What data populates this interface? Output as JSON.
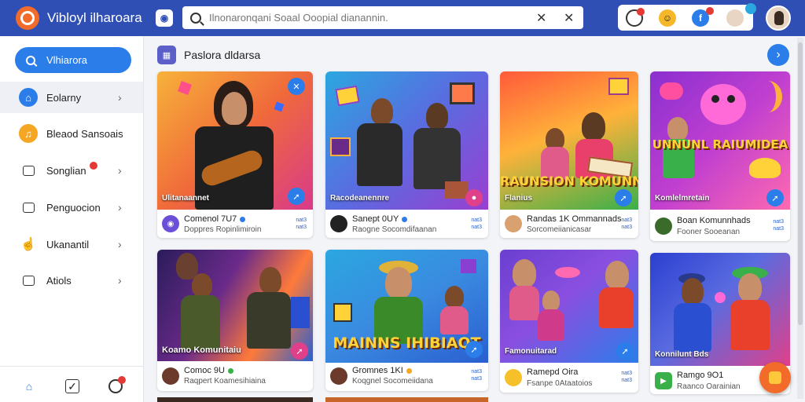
{
  "app": {
    "title": "Vibloyl ilharoara",
    "search_placeholder": "Ilnonaronqani Soaal Ooopial dianannin."
  },
  "sidebar": {
    "search_label": "Vlhiarora",
    "items": [
      {
        "label": "Eolarny"
      },
      {
        "label": "Bleaod Sansoais"
      },
      {
        "label": "Songlian"
      },
      {
        "label": "Penguocion"
      },
      {
        "label": "Ukanantil"
      },
      {
        "label": "Atiols"
      }
    ]
  },
  "section": {
    "title": "Paslora dldarsa"
  },
  "cards": [
    {
      "overlay": "Ulitanaannet",
      "banner": "",
      "title": "Comenol 7U7",
      "sub": "Doppres Ropinlimiroin",
      "stats": [
        "nat3",
        "nat3",
        "nat3"
      ],
      "colors": {
        "bg1": "#f09a2c",
        "bg2": "#e0408a",
        "av": "#6b4fd8",
        "dot": "#2b7de9",
        "btn": "#2b7de9"
      }
    },
    {
      "overlay": "Racodeanennre",
      "banner": "",
      "title": "Sanept 0UY",
      "sub": "Raogne Socomdifaanan",
      "stats": [
        "nat3",
        "nat3",
        "nat3"
      ],
      "colors": {
        "bg1": "#2ba7e0",
        "bg2": "#8a3fd0",
        "av": "#222222",
        "dot": "#2b7de9",
        "btn": "#e0408a"
      }
    },
    {
      "overlay": "Flanius",
      "banner": "RAUNSION KOMUNNS",
      "title": "Randas 1K Ommannads",
      "sub": "Sorcomeiianicasar",
      "stats": [
        "nat3",
        "nat3",
        "nat3"
      ],
      "colors": {
        "bg1": "#ff7a2e",
        "bg2": "#3ab04a",
        "av": "#d9a070",
        "dot": "",
        "btn": "#2b7de9"
      }
    },
    {
      "overlay": "Komlelmretain",
      "banner": "UNNUNL RAIUMIDEA",
      "title": "Boan Komunnhads",
      "sub": "Fooner Sooeanan",
      "stats": [
        "nat3",
        "nat3",
        "nat3"
      ],
      "colors": {
        "bg1": "#7a2fd0",
        "bg2": "#ff5aa8",
        "av": "#3a6b2a",
        "dot": "",
        "btn": "#2b7de9"
      }
    },
    {
      "overlay": "Koamo Komunitaiu",
      "banner": "",
      "title": "Comoc 9U",
      "sub": "Raqpert Koamesihiaina",
      "stats": [],
      "colors": {
        "bg1": "#3a2a8a",
        "bg2": "#e0408a",
        "av": "#6b3a2a",
        "dot": "#3ab04a",
        "btn": "#e0408a"
      }
    },
    {
      "overlay": "",
      "banner": "MAINNS IHIBIAQT",
      "title": "Gromnes 1KI",
      "sub": "Koqgnel Socomeiidana",
      "stats": [
        "nat3",
        "nat3",
        "nat3"
      ],
      "colors": {
        "bg1": "#2ba7e0",
        "bg2": "#2a5fd0",
        "av": "#6b3a2a",
        "dot": "#f5a623",
        "btn": "#2b7de9"
      }
    },
    {
      "overlay": "Famonuitarad",
      "banner": "",
      "title": "Ramepd Oira",
      "sub": "Fsanpe 0Ataatoios",
      "stats": [
        "nat3",
        "nat3",
        "nat3"
      ],
      "colors": {
        "bg1": "#7a3fd0",
        "bg2": "#2b7de9",
        "av": "#f5c02a",
        "dot": "",
        "btn": "#2b7de9"
      }
    },
    {
      "overlay": "Konnilunt Bds",
      "banner": "",
      "title": "Ramgo 9O1",
      "sub": "Raanco Oarainian",
      "stats": [
        "nat3",
        "nat3",
        "nat3"
      ],
      "colors": {
        "bg1": "#2b5fd0",
        "bg2": "#e0408a",
        "av": "#3ab04a",
        "dot": "",
        "btn": "#2b7de9"
      }
    }
  ]
}
